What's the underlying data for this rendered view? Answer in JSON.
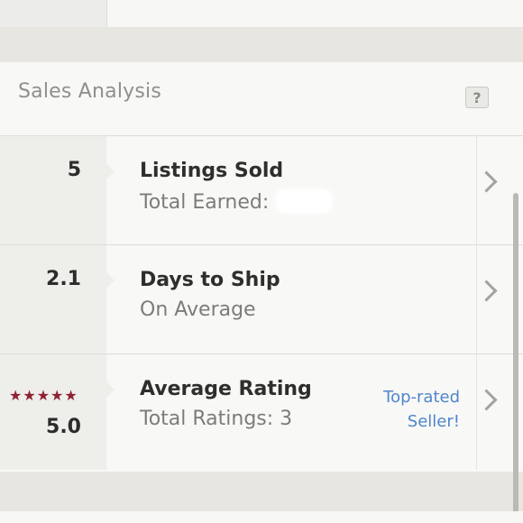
{
  "section": {
    "title": "Sales Analysis",
    "help_label": "?"
  },
  "rows": [
    {
      "value": "5",
      "title": "Listings Sold",
      "subtitle": "Total Earned:"
    },
    {
      "value": "2.1",
      "title": "Days to Ship",
      "subtitle": "On Average"
    },
    {
      "stars": "★★★★★",
      "value": "5.0",
      "title": "Average Rating",
      "subtitle": "Total Ratings: 3",
      "badge_line1": "Top-rated",
      "badge_line2": "Seller!"
    }
  ],
  "colors": {
    "accent_link": "#4f86cc",
    "star": "#8f2133",
    "background": "#e7e6e1",
    "card": "#f8f8f6"
  },
  "icons": {
    "help": "question-icon",
    "row_arrow": "chevron-right-icon",
    "rating": "star-icon"
  }
}
